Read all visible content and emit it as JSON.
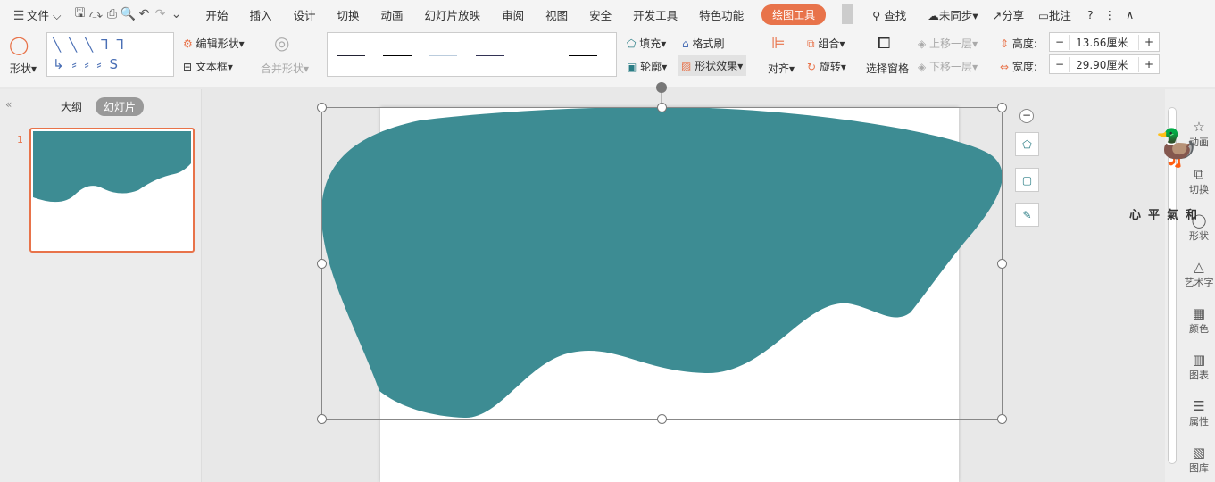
{
  "menubar": {
    "file": "文件",
    "tabs": [
      "开始",
      "插入",
      "设计",
      "切换",
      "动画",
      "幻灯片放映",
      "审阅",
      "视图",
      "安全",
      "开发工具",
      "特色功能"
    ],
    "active_tab": "绘图工具",
    "search": "查找",
    "sync": "未同步",
    "share": "分享",
    "comment": "批注"
  },
  "ribbon": {
    "shape": "形状",
    "edit_shape": "编辑形状",
    "textbox": "文本框",
    "merge_shape": "合并形状",
    "fill": "填充",
    "format_painter": "格式刷",
    "outline": "轮廓",
    "shape_effect": "形状效果",
    "align": "对齐",
    "group": "组合",
    "rotate": "旋转",
    "selection_pane": "选择窗格",
    "bring_forward": "上移一层",
    "send_backward": "下移一层",
    "height_label": "高度:",
    "height_value": "13.66厘米",
    "width_label": "宽度:",
    "width_value": "29.90厘米"
  },
  "left_panel": {
    "tabs": [
      "大纲",
      "幻灯片"
    ],
    "slide_number": "1"
  },
  "right_panel": {
    "items": [
      "动画",
      "切换",
      "形状",
      "艺术字",
      "颜色",
      "图表",
      "属性",
      "图库"
    ]
  },
  "sticker_text": "心平氣和",
  "colors": {
    "shape": "#3d8c93",
    "accent": "#e8734a"
  }
}
